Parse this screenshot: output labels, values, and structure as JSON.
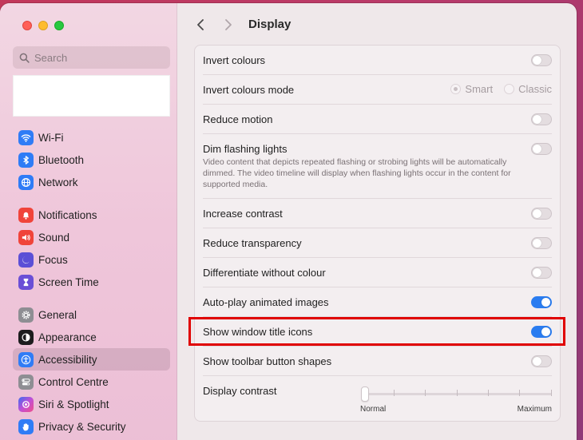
{
  "sidebar": {
    "search_placeholder": "Search",
    "groups": [
      [
        {
          "label": "Wi-Fi",
          "icon": "wifi-icon",
          "color": "#2f7cf6"
        },
        {
          "label": "Bluetooth",
          "icon": "bluetooth-icon",
          "color": "#2f7cf6"
        },
        {
          "label": "Network",
          "icon": "globe-icon",
          "color": "#2f7cf6"
        }
      ],
      [
        {
          "label": "Notifications",
          "icon": "bell-icon",
          "color": "#f0443a"
        },
        {
          "label": "Sound",
          "icon": "speaker-icon",
          "color": "#f0443a"
        },
        {
          "label": "Focus",
          "icon": "moon-icon",
          "color": "#5b4fd6"
        },
        {
          "label": "Screen Time",
          "icon": "hourglass-icon",
          "color": "#6a4fd6"
        }
      ],
      [
        {
          "label": "General",
          "icon": "gear-icon",
          "color": "#8e8e93"
        },
        {
          "label": "Appearance",
          "icon": "appearance-icon",
          "color": "#1c1c1e"
        },
        {
          "label": "Accessibility",
          "icon": "accessibility-icon",
          "color": "#2f7cf6",
          "selected": true
        },
        {
          "label": "Control Centre",
          "icon": "control-centre-icon",
          "color": "#8e8e93"
        },
        {
          "label": "Siri & Spotlight",
          "icon": "siri-icon",
          "color": "#b04fd6"
        },
        {
          "label": "Privacy & Security",
          "icon": "hand-icon",
          "color": "#2f7cf6"
        }
      ]
    ]
  },
  "header": {
    "title": "Display"
  },
  "settings": {
    "invert_colours": {
      "label": "Invert colours",
      "on": false
    },
    "invert_mode": {
      "label": "Invert colours mode",
      "options": [
        "Smart",
        "Classic"
      ],
      "selected": "Smart"
    },
    "reduce_motion": {
      "label": "Reduce motion",
      "on": false
    },
    "dim_flashing": {
      "label": "Dim flashing lights",
      "description": "Video content that depicts repeated flashing or strobing lights will be automatically dimmed. The video timeline will display when flashing lights occur in the content for supported media.",
      "on": false
    },
    "increase_contrast": {
      "label": "Increase contrast",
      "on": false
    },
    "reduce_transparency": {
      "label": "Reduce transparency",
      "on": false
    },
    "differentiate": {
      "label": "Differentiate without colour",
      "on": false
    },
    "autoplay": {
      "label": "Auto-play animated images",
      "on": true
    },
    "title_icons": {
      "label": "Show window title icons",
      "on": true
    },
    "toolbar_shapes": {
      "label": "Show toolbar button shapes",
      "on": false
    },
    "display_contrast": {
      "label": "Display contrast",
      "min_label": "Normal",
      "max_label": "Maximum",
      "value": 0
    }
  }
}
